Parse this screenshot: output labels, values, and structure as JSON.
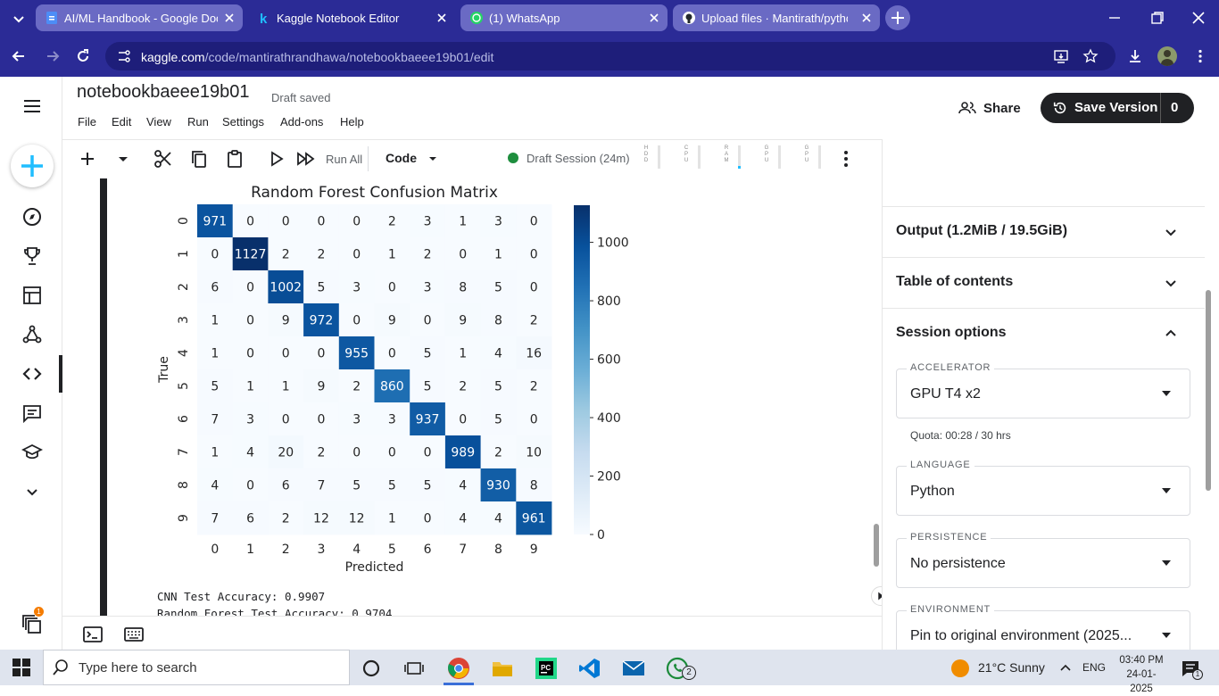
{
  "browser": {
    "tabs": [
      {
        "label": "AI/ML Handbook - Google Doc",
        "favicon": "google-docs-icon"
      },
      {
        "label": "Kaggle Notebook Editor",
        "favicon": "kaggle-icon"
      },
      {
        "label": "(1) WhatsApp",
        "favicon": "whatsapp-icon"
      },
      {
        "label": "Upload files · Mantirath/python",
        "favicon": "github-icon"
      }
    ],
    "url_host": "kaggle.com",
    "url_path": "/code/mantirathrandhawa/notebookbaeee19b01/edit",
    "colors": {
      "chrome": "#2b2b96",
      "omnibox": "#1e1e7a"
    }
  },
  "notebook": {
    "title": "notebookbaeee19b01",
    "status": "Draft saved",
    "menu": [
      "File",
      "Edit",
      "View",
      "Run",
      "Settings",
      "Add-ons",
      "Help"
    ],
    "share_label": "Share",
    "save_version_label": "Save Version",
    "save_version_count": "0",
    "toolbar": {
      "run_all_label": "Run All",
      "cell_type": "Code",
      "session_label": "Draft Session (24m)",
      "meters": [
        "HDD",
        "CPU",
        "RAM",
        "GPU",
        "GPU"
      ]
    },
    "output_lines": [
      "CNN Test Accuracy: 0.9907",
      "Random Forest Test Accuracy: 0.9704"
    ]
  },
  "right_panel": {
    "sections": [
      {
        "title": "Output (1.2MiB / 19.5GiB)",
        "expanded": false
      },
      {
        "title": "Table of contents",
        "expanded": false
      },
      {
        "title": "Session options",
        "expanded": true
      }
    ],
    "fields": [
      {
        "label": "ACCELERATOR",
        "value": "GPU T4 x2"
      },
      {
        "label": "LANGUAGE",
        "value": "Python"
      },
      {
        "label": "PERSISTENCE",
        "value": "No persistence"
      },
      {
        "label": "ENVIRONMENT",
        "value": "Pin to original environment (2025..."
      }
    ],
    "quota": "Quota: 00:28 / 30 hrs"
  },
  "left_nav": {
    "icons": [
      "create-icon",
      "compass-icon",
      "trophy-icon",
      "table-icon",
      "models-icon",
      "code-icon",
      "comments-icon",
      "learn-icon",
      "more-chevron-icon",
      "stack-icon"
    ],
    "badge": "1"
  },
  "chart_data": {
    "type": "heatmap",
    "title": "Random Forest Confusion Matrix",
    "xlabel": "Predicted",
    "ylabel": "True",
    "x_categories": [
      "0",
      "1",
      "2",
      "3",
      "4",
      "5",
      "6",
      "7",
      "8",
      "9"
    ],
    "y_categories": [
      "0",
      "1",
      "2",
      "3",
      "4",
      "5",
      "6",
      "7",
      "8",
      "9"
    ],
    "values": [
      [
        971,
        0,
        0,
        0,
        0,
        2,
        3,
        1,
        3,
        0
      ],
      [
        0,
        1127,
        2,
        2,
        0,
        1,
        2,
        0,
        1,
        0
      ],
      [
        6,
        0,
        1002,
        5,
        3,
        0,
        3,
        8,
        5,
        0
      ],
      [
        1,
        0,
        9,
        972,
        0,
        9,
        0,
        9,
        8,
        2
      ],
      [
        1,
        0,
        0,
        0,
        955,
        0,
        5,
        1,
        4,
        16
      ],
      [
        5,
        1,
        1,
        9,
        2,
        860,
        5,
        2,
        5,
        2
      ],
      [
        7,
        3,
        0,
        0,
        3,
        3,
        937,
        0,
        5,
        0
      ],
      [
        1,
        4,
        20,
        2,
        0,
        0,
        0,
        989,
        2,
        10
      ],
      [
        4,
        0,
        6,
        7,
        5,
        5,
        5,
        4,
        930,
        8
      ],
      [
        7,
        6,
        2,
        12,
        12,
        1,
        0,
        4,
        4,
        961
      ]
    ],
    "colorbar_ticks": [
      "0",
      "200",
      "400",
      "600",
      "800",
      "1000"
    ],
    "color_range": [
      0,
      1127
    ],
    "colormap": "Blues"
  },
  "taskbar": {
    "search_placeholder": "Type here to search",
    "weather": "21°C  Sunny",
    "lang": "ENG",
    "time": "03:40 PM",
    "date": "24-01-2025",
    "notification_count": "1",
    "whatsapp_badge": "2"
  }
}
